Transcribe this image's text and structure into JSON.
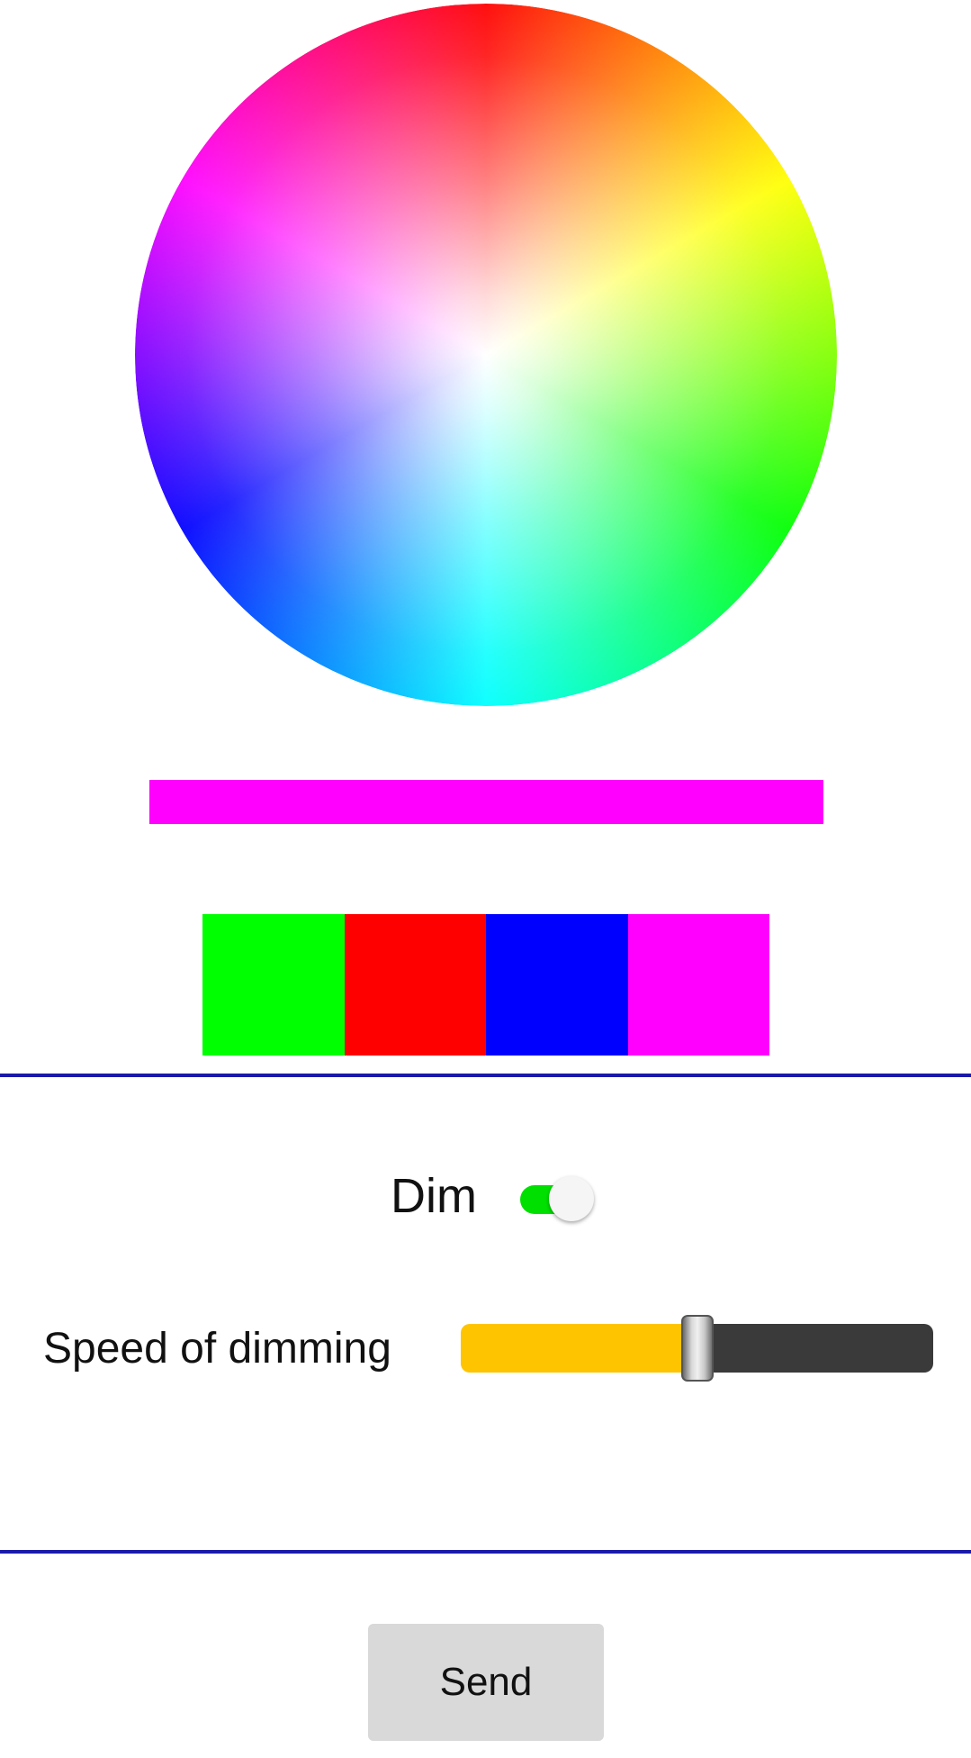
{
  "color_picker": {
    "wheel_icon": "hue-saturation-color-wheel",
    "selected_color": "#ff00ff"
  },
  "swatches": [
    {
      "name": "green",
      "color": "#00ff00"
    },
    {
      "name": "red",
      "color": "#ff0000"
    },
    {
      "name": "blue",
      "color": "#0000ff"
    },
    {
      "name": "magenta",
      "color": "#ff00ff"
    }
  ],
  "divider_color": "#1a1aaa",
  "dim": {
    "label": "Dim",
    "enabled": true,
    "toggle_on_color": "#00e000"
  },
  "speed": {
    "label": "Speed of dimming",
    "value": 0.5,
    "fill_color": "#ffc400",
    "track_color": "#3a3a3a"
  },
  "send": {
    "label": "Send"
  }
}
